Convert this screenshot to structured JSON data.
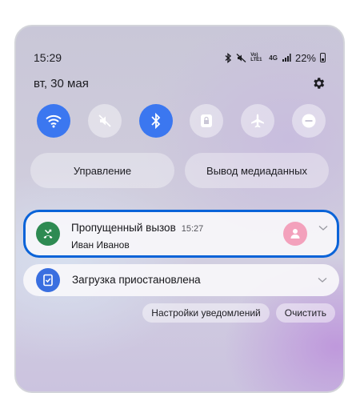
{
  "status_bar": {
    "time": "15:29",
    "icons": [
      "bluetooth-icon",
      "mute-icon",
      "volte-icon",
      "4g-icon",
      "signal-icon"
    ],
    "volte_label": "Vo) LTE1",
    "network_label": "4G",
    "battery": "22%"
  },
  "date": "вт, 30 мая",
  "quick_toggles": [
    {
      "icon": "wifi-icon",
      "active": true
    },
    {
      "icon": "mute-icon",
      "active": false
    },
    {
      "icon": "bluetooth-icon",
      "active": true
    },
    {
      "icon": "rotation-lock-icon",
      "active": false
    },
    {
      "icon": "airplane-icon",
      "active": false
    },
    {
      "icon": "do-not-disturb-icon",
      "active": false
    }
  ],
  "buttons": {
    "control": "Управление",
    "media_output": "Вывод медиаданных"
  },
  "notifications": [
    {
      "title": "Пропущенный вызов",
      "time": "15:27",
      "subtitle": "Иван Иванов",
      "icon_color": "#2e8a52",
      "icon": "missed-call-icon"
    },
    {
      "title": "Загрузка приостановлена",
      "icon_color": "#3a6fe0",
      "icon": "download-paused-icon"
    }
  ],
  "actions": {
    "notification_settings": "Настройки уведомлений",
    "clear": "Очистить"
  },
  "colors": {
    "accent": "#3b77f0",
    "highlight_border": "#0a63d8",
    "avatar": "#f3a1bc"
  }
}
